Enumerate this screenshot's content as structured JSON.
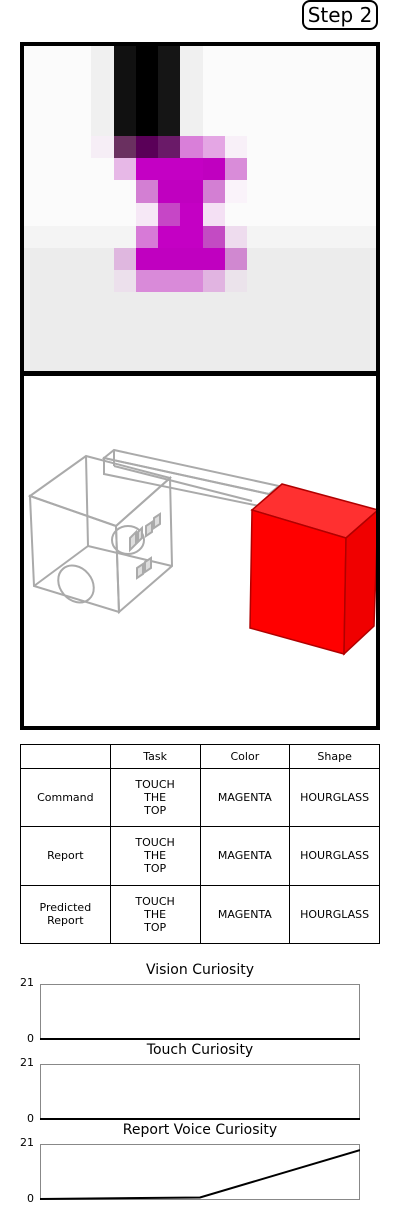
{
  "step_label": "Step 2",
  "report_table": {
    "columns": [
      "",
      "Task",
      "Color",
      "Shape"
    ],
    "rows": [
      {
        "label": "Command",
        "task": "TOUCH\nTHE\nTOP",
        "color": "MAGENTA",
        "shape": "HOURGLASS"
      },
      {
        "label": "Report",
        "task": "TOUCH\nTHE\nTOP",
        "color": "MAGENTA",
        "shape": "HOURGLASS"
      },
      {
        "label": "Predicted\nReport",
        "task": "TOUCH\nTHE\nTOP",
        "color": "MAGENTA",
        "shape": "HOURGLASS"
      }
    ]
  },
  "colors": {
    "object": "#ff0000",
    "target": "#c400c4",
    "gripper": "#000000"
  },
  "chart_data": [
    {
      "type": "line",
      "title": "Vision Curiosity",
      "ylim": [
        0,
        21
      ],
      "x": [
        0,
        1,
        2
      ],
      "values": [
        0,
        0,
        0
      ]
    },
    {
      "type": "line",
      "title": "Touch Curiosity",
      "ylim": [
        0,
        21
      ],
      "x": [
        0,
        1,
        2
      ],
      "values": [
        0,
        0,
        0
      ]
    },
    {
      "type": "line",
      "title": "Report Voice Curiosity",
      "ylim": [
        0,
        21
      ],
      "x": [
        0,
        1,
        2
      ],
      "values": [
        0,
        0.6,
        19
      ]
    }
  ]
}
